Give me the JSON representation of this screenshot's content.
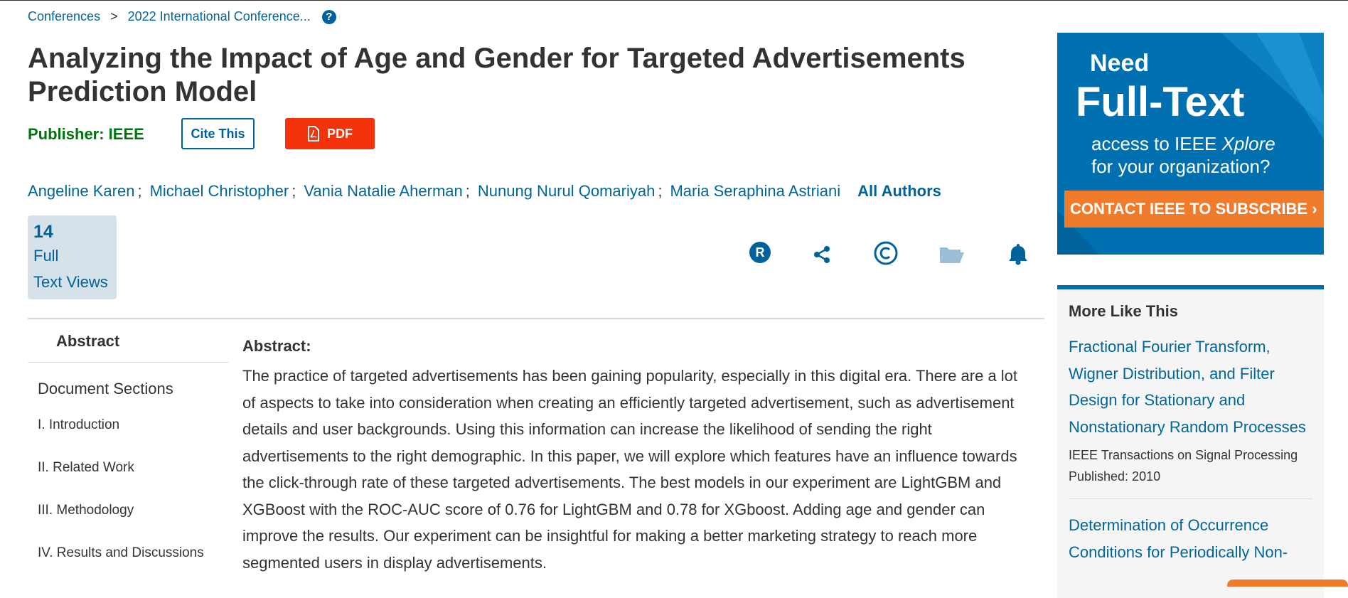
{
  "breadcrumb": {
    "item1": "Conferences",
    "sep": ">",
    "item2": "2022 International Conference...",
    "help": "?"
  },
  "title": "Analyzing the Impact of Age and Gender for Targeted Advertisements Prediction Model",
  "publisher": "Publisher:  IEEE",
  "buttons": {
    "cite": "Cite This",
    "pdf": "PDF"
  },
  "authors": [
    "Angeline Karen",
    "Michael Christopher",
    "Vania Natalie Aherman",
    "Nunung Nurul Qomariyah",
    "Maria Seraphina Astriani"
  ],
  "author_sep": ";",
  "all_authors": "All Authors",
  "views": {
    "count": "14",
    "line1": "Full",
    "line2": "Text Views"
  },
  "icons": [
    "rights-icon",
    "share-icon",
    "copyright-icon",
    "folder-icon",
    "alert-bell-icon"
  ],
  "sidebar": {
    "abstract": "Abstract",
    "heading": "Document Sections",
    "items": [
      "I.  Introduction",
      "II.  Related Work",
      "III.  Methodology",
      "IV.  Results and Discussions"
    ]
  },
  "abstract": {
    "label": "Abstract:",
    "text": "The practice of targeted advertisements has been gaining popularity, especially in this digital era. There are a lot of aspects to take into consideration when creating an efficiently targeted advertisement, such as advertisement details and user backgrounds. Using this information can increase the likelihood of sending the right advertisements to the right demographic. In this paper, we will explore which features have an influence towards the click-through rate of these targeted advertisements. The best models in our experiment are LightGBM and XGBoost with the ROC-AUC score of 0.76 for LightGBM and 0.78 for XGboost. Adding age and gender can improve the results. Our experiment can be insightful for making a better marketing strategy to reach more segmented users in display advertisements."
  },
  "ad": {
    "need": "Need",
    "full_text": "Full-Text",
    "sub_line1_a": "access to IEEE ",
    "sub_line1_b": "Xplore",
    "sub_line2": "for your organization?",
    "cta": "CONTACT IEEE TO SUBSCRIBE ›"
  },
  "more_like_this": {
    "heading": "More Like This",
    "items": [
      {
        "title": "Fractional Fourier Transform, Wigner Distribution, and Filter Design for Stationary and Nonstationary Random Processes",
        "journal": "IEEE Transactions on Signal Processing",
        "published": "Published: 2010"
      },
      {
        "title": "Determination of Occurrence Conditions for Periodically Non-"
      }
    ]
  },
  "colors": {
    "ieee_blue": "#00629b",
    "link": "#006699",
    "pdf_red": "#f2330b",
    "publisher_green": "#00730d",
    "ad_orange": "#f07c2b"
  }
}
